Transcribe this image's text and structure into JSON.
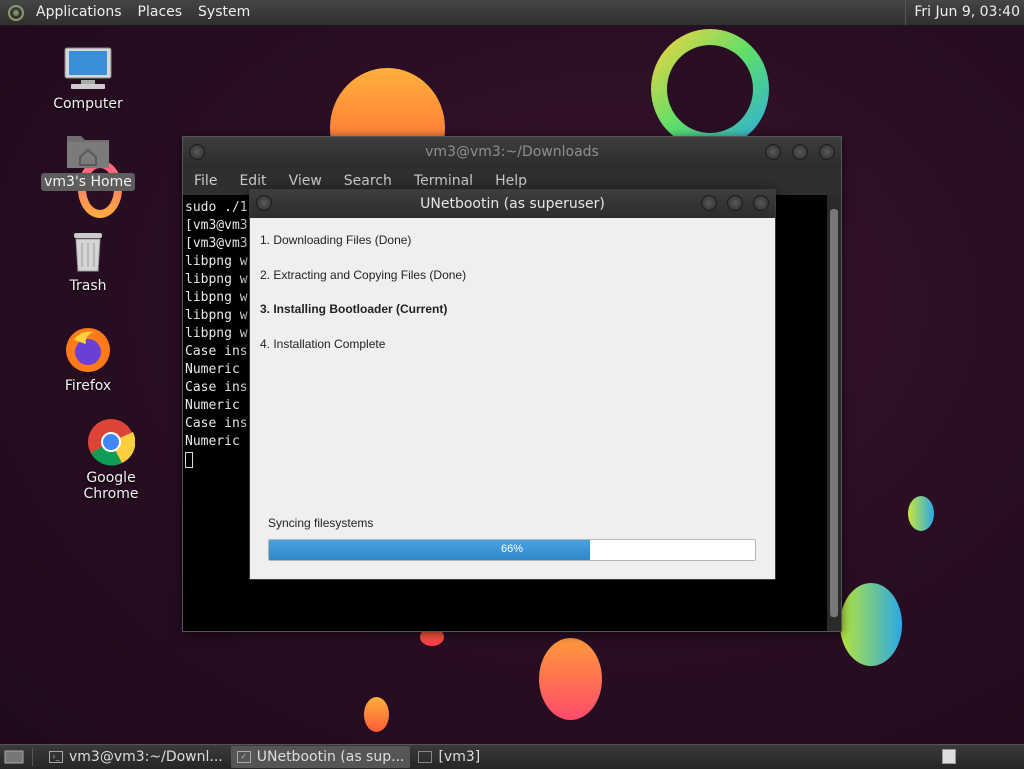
{
  "top_panel": {
    "menus": [
      "Applications",
      "Places",
      "System"
    ],
    "clock": "Fri Jun  9, 03:40"
  },
  "desktop": {
    "icons": [
      {
        "label": "Computer",
        "icon": "computer-icon"
      },
      {
        "label": "vm3's Home",
        "icon": "home-folder-icon"
      },
      {
        "label": "Trash",
        "icon": "trash-icon"
      },
      {
        "label": "Firefox",
        "icon": "firefox-icon"
      },
      {
        "label": "Google Chrome",
        "icon": "chrome-icon"
      }
    ]
  },
  "terminal": {
    "title": "vm3@vm3:~/Downloads",
    "menu": [
      "File",
      "Edit",
      "View",
      "Search",
      "Terminal",
      "Help"
    ],
    "lines": [
      "sudo ./1",
      "[vm3@vm3",
      "[vm3@vm3",
      "libpng w",
      "libpng w",
      "libpng w",
      "libpng w",
      "libpng w",
      "Case ins",
      "Numeric ",
      "Case ins",
      "Numeric ",
      "Case ins",
      "Numeric "
    ]
  },
  "dialog": {
    "title": "UNetbootin (as superuser)",
    "steps": [
      "1. Downloading Files (Done)",
      "2. Extracting and Copying Files (Done)",
      "3. Installing Bootloader (Current)",
      "4. Installation Complete"
    ],
    "current_step": 3,
    "status": "Syncing filesystems",
    "progress_percent": 66,
    "progress_label": "66%"
  },
  "taskbar": {
    "tasks": [
      {
        "label": "vm3@vm3:~/Downl...",
        "active": false
      },
      {
        "label": "UNetbootin (as sup...",
        "active": true
      },
      {
        "label": "[vm3]",
        "active": false
      }
    ]
  },
  "colors": {
    "progress": "#3a93d4",
    "desktop_bg": "#2a0e24"
  }
}
